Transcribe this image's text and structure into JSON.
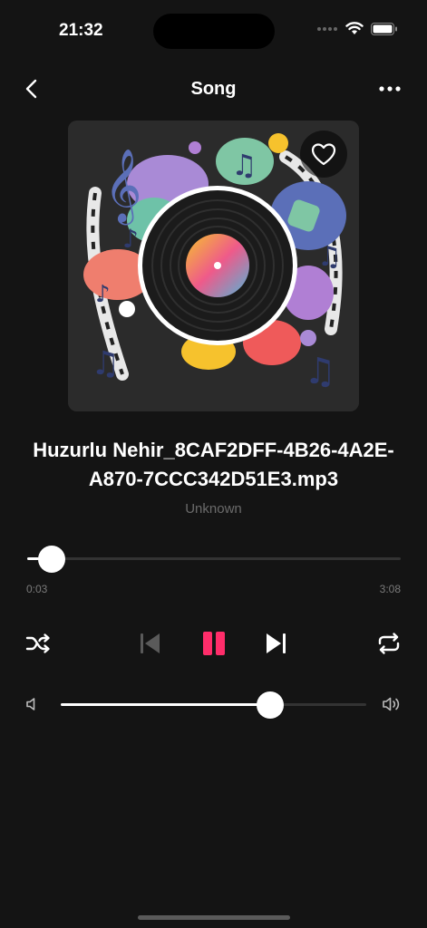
{
  "status_bar": {
    "time": "21:32",
    "icons": [
      "signal-dots-icon",
      "wifi-icon",
      "battery-icon"
    ]
  },
  "nav": {
    "title": "Song",
    "back_icon": "chevron-left-icon",
    "more_icon": "more-horizontal-icon"
  },
  "artwork": {
    "favorite_icon": "heart-icon"
  },
  "song": {
    "title": "Huzurlu Nehir_8CAF2DFF-4B26-4A2E-A870-7CCC342D51E3.mp3",
    "artist": "Unknown"
  },
  "progress": {
    "current": "0:03",
    "total": "3:08",
    "fraction": 0.016
  },
  "controls": {
    "shuffle_icon": "shuffle-icon",
    "previous_icon": "skip-previous-icon",
    "play_pause_icon": "pause-icon",
    "next_icon": "skip-next-icon",
    "repeat_icon": "repeat-icon",
    "accent_color": "#ff2d6a"
  },
  "volume": {
    "fraction": 0.685,
    "low_icon": "volume-low-icon",
    "high_icon": "volume-high-icon"
  }
}
